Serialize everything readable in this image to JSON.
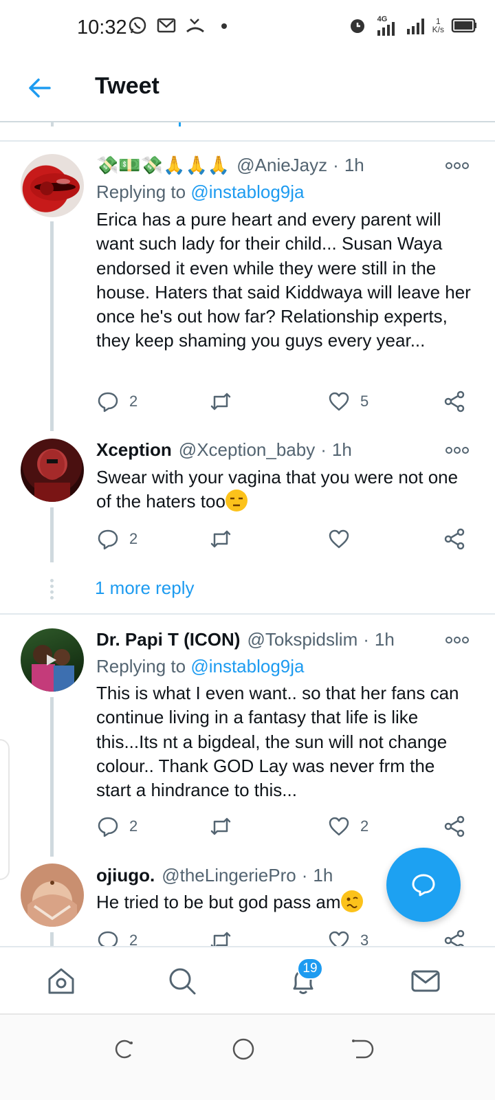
{
  "status_bar": {
    "time": "10:32",
    "network_label": "4G",
    "speed_value": "1",
    "speed_unit": "K/s"
  },
  "header": {
    "title": "Tweet"
  },
  "colors": {
    "accent": "#1d9bf0",
    "fab": "#1da1f2",
    "text_primary": "#0f1419",
    "text_secondary": "#536471",
    "divider": "#e1e8ed"
  },
  "tweets": [
    {
      "name": "💸💵💸🙏🙏🙏",
      "handle": "@AnieJayz",
      "time": "1h",
      "replying_prefix": "Replying to",
      "replying_to": "@instablog9ja",
      "text": "Erica has a pure heart and every parent will want such lady for their child... Susan Waya endorsed it even while they were still in the house. Haters that said Kiddwaya will leave her once he's out how far? Relationship experts, they keep shaming you guys every year...",
      "replies": "2",
      "retweets": "",
      "likes": "5"
    },
    {
      "name": "Xception",
      "handle": "@Xception_baby",
      "time": "1h",
      "text": "Swear with your vagina that you were not one of the haters too",
      "replies": "2",
      "retweets": "",
      "likes": ""
    },
    {
      "name": "Dr. Papi T (ICON)",
      "handle": "@Tokspidslim",
      "time": "1h",
      "replying_prefix": "Replying to",
      "replying_to": "@instablog9ja",
      "text": "This is what I even want.. so that her fans can continue living in a fantasy that life is like this...Its nt a bigdeal, the sun will not change colour.. Thank GOD Lay was never frm the start a hindrance to this...",
      "replies": "2",
      "retweets": "",
      "likes": "2"
    },
    {
      "name": "ojiugo.",
      "handle": "@theLingeriePro",
      "time": "1h",
      "text": "He tried to be but god pass am",
      "replies": "2",
      "retweets": "",
      "likes": "3"
    }
  ],
  "more_replies": "1 more reply",
  "bottom_nav": {
    "items": [
      "home-icon",
      "search-icon",
      "notifications-icon",
      "messages-icon"
    ],
    "notification_count": "19"
  }
}
